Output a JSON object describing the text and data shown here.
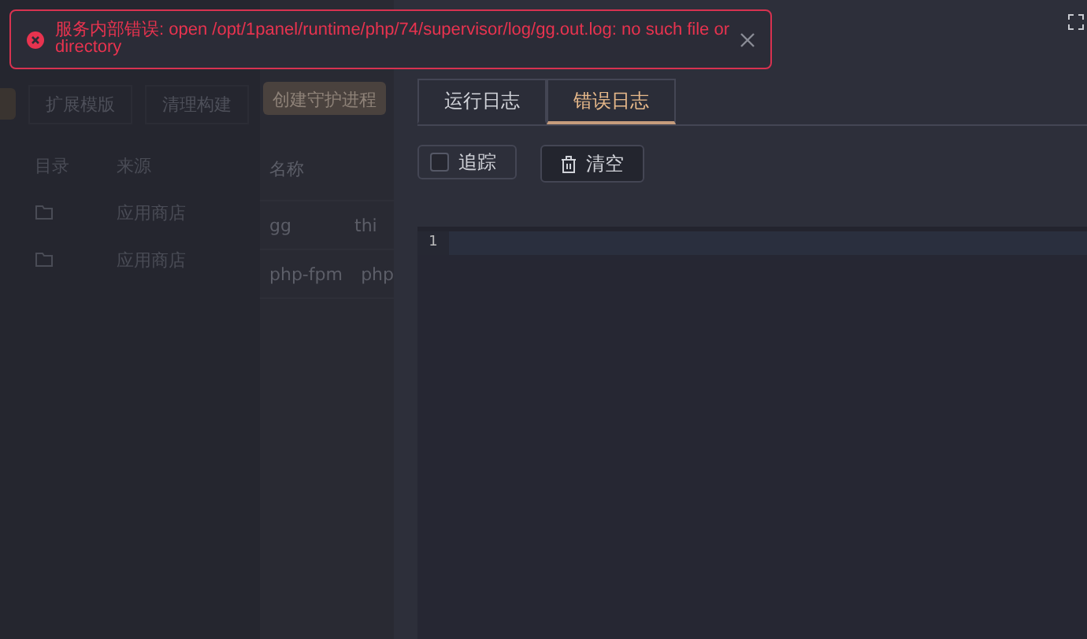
{
  "background": {
    "left_tabs": [
      "扩展模版",
      "清理构建"
    ],
    "left_columns": [
      "目录",
      "来源"
    ],
    "left_rows": [
      {
        "source": "应用商店"
      },
      {
        "source": "应用商店"
      }
    ],
    "create_button": "创建守护进程",
    "columns": [
      "名称"
    ],
    "rows": [
      {
        "name": "gg",
        "column_2": "thi"
      },
      {
        "name": "php-fpm",
        "column_2": "php"
      }
    ]
  },
  "toast": {
    "message": "服务内部错误: open /opt/1panel/runtime/php/74/supervisor/log/gg.out.log: no such file or directory"
  },
  "drawer": {
    "tabs": [
      {
        "label": "运行日志",
        "selected": false
      },
      {
        "label": "错误日志",
        "selected": true
      }
    ],
    "follow": {
      "label": "追踪",
      "checked": false
    },
    "clear_button": "清空",
    "editor": {
      "line_numbers": [
        "1"
      ]
    }
  }
}
